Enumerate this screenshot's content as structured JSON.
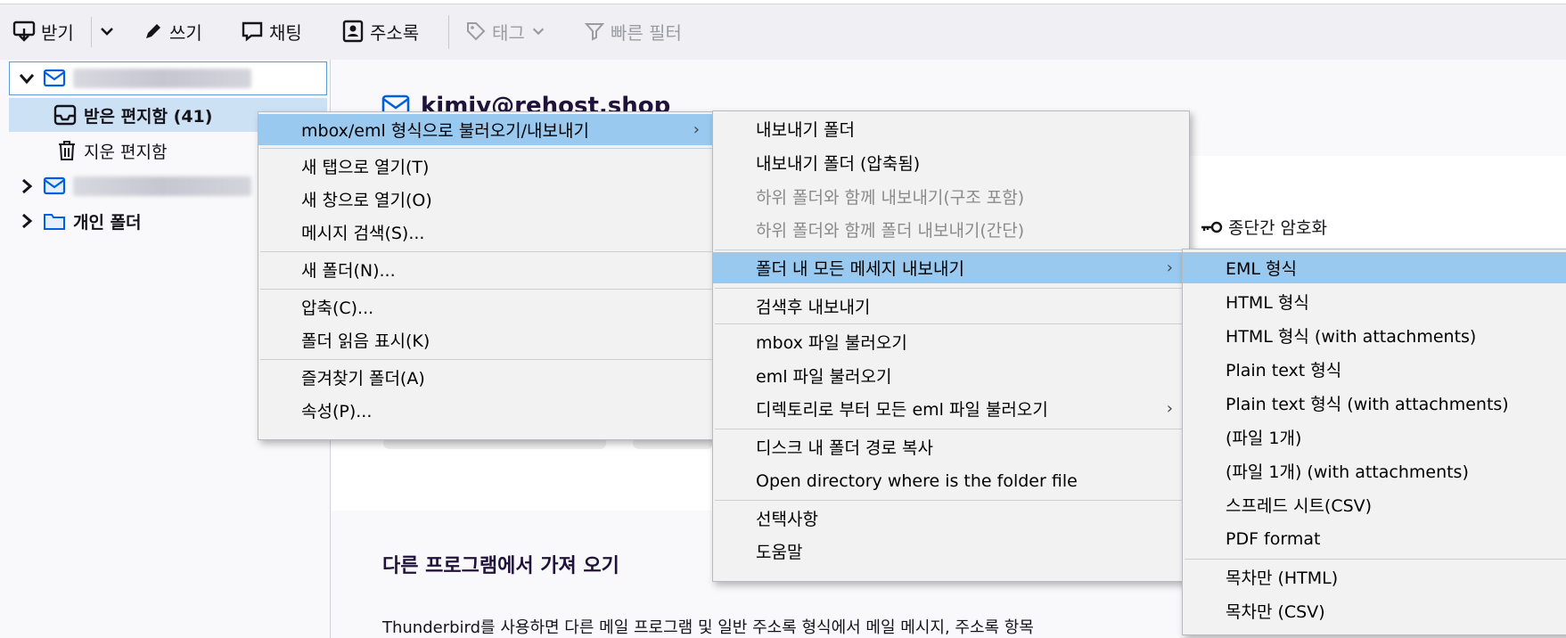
{
  "toolbar": {
    "get_mail": "받기",
    "write": "쓰기",
    "chat": "채팅",
    "address_book": "주소록",
    "tag": "태그",
    "quick_filter": "빠른 필터"
  },
  "folders": {
    "inbox": "받은 편지함 (41)",
    "trash": "지운 편지함",
    "local_folders": "개인 폴더"
  },
  "content": {
    "account_email_partial": "kimjy@rehost.shop",
    "e2e_encryption": "종단간 암호화",
    "import_heading": "다른 프로그램에서 가져 오기",
    "import_description": "Thunderbird를 사용하면 다른 메일 프로그램 및 일반 주소록 형식에서 메일 메시지, 주소록 항목"
  },
  "context_menu": [
    {
      "label": "mbox/eml 형식으로 불러오기/내보내기",
      "submenu": true,
      "highlighted": true
    },
    {
      "label": "새 탭으로 열기(T)"
    },
    {
      "label": "새 창으로 열기(O)"
    },
    {
      "label": "메시지 검색(S)..."
    },
    {
      "label": "새 폴더(N)..."
    },
    {
      "label": "압축(C)..."
    },
    {
      "label": "폴더 읽음 표시(K)"
    },
    {
      "label": "즐겨찾기 폴더(A)"
    },
    {
      "label": "속성(P)..."
    }
  ],
  "submenu_1": [
    {
      "label": "내보내기 폴더"
    },
    {
      "label": "내보내기 폴더 (압축됨)"
    },
    {
      "label": "하위 폴더와 함께 내보내기(구조 포함)",
      "disabled": true
    },
    {
      "label": "하위 폴더와 함께 폴더 내보내기(간단)",
      "disabled": true
    },
    {
      "label": "폴더 내 모든 메세지 내보내기",
      "submenu": true,
      "highlighted": true
    },
    {
      "label": "검색후 내보내기"
    },
    {
      "label": "mbox 파일 불러오기"
    },
    {
      "label": "eml 파일 불러오기"
    },
    {
      "label": "디렉토리로 부터 모든 eml 파일 불러오기",
      "submenu": true
    },
    {
      "label": "디스크 내 폴더 경로 복사"
    },
    {
      "label": "Open directory where is the folder file"
    },
    {
      "label": "선택사항"
    },
    {
      "label": "도움말"
    }
  ],
  "submenu_2": [
    {
      "label": "EML 형식",
      "highlighted": true
    },
    {
      "label": "HTML 형식"
    },
    {
      "label": "HTML 형식 (with attachments)"
    },
    {
      "label": "Plain text 형식"
    },
    {
      "label": "Plain text 형식 (with attachments)"
    },
    {
      "label": "(파일 1개)"
    },
    {
      "label": "(파일 1개) (with attachments)"
    },
    {
      "label": "스프레드 시트(CSV)"
    },
    {
      "label": "PDF format"
    },
    {
      "label": "목차만 (HTML)"
    },
    {
      "label": "목차만 (CSV)"
    }
  ],
  "colors": {
    "highlight": "#99c9ef",
    "accent_blue": "#0060df",
    "heading_navy": "#20123a"
  }
}
